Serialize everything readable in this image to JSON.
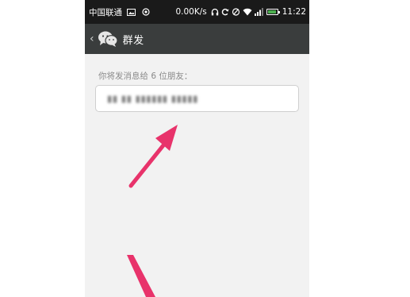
{
  "status_bar": {
    "carrier": "中国联通",
    "speed": "0.00K/s",
    "time": "11:22",
    "icons": [
      "image-icon",
      "record-icon",
      "headset-icon",
      "sync-icon",
      "mute-icon",
      "wifi-icon",
      "signal-icon",
      "battery-icon"
    ]
  },
  "title_bar": {
    "back_icon": "chevron-left-icon",
    "app_icon": "wechat-icon",
    "title": "群发"
  },
  "compose": {
    "hint": "你将发消息给 6 位朋友：",
    "recipients": "▮▮ ▮▮ ▮▮▮▮▮▮ ▮▮▮▮▮"
  },
  "annotations": {
    "arrow_color": "#e8336b"
  },
  "colors": {
    "status_bar_bg": "#1a1a1a",
    "title_bar_bg": "#3a3d3d",
    "page_bg": "#f2f2f2"
  }
}
